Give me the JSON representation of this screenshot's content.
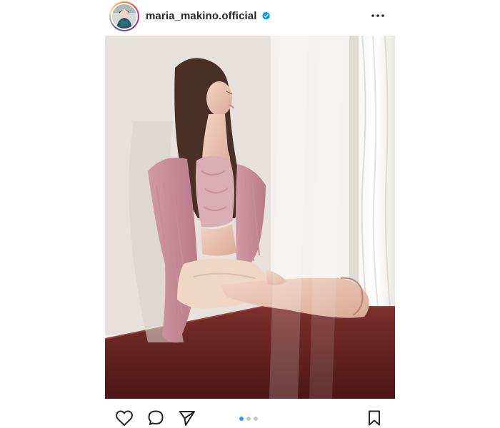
{
  "post": {
    "username": "maria_makino.official",
    "verified": true,
    "carousel": {
      "total": 3,
      "active_index": 0
    },
    "photo": {
      "description_icon": "photo"
    }
  },
  "icons": {
    "verified": "verified-badge-icon",
    "more": "more-options-icon",
    "like": "heart-icon",
    "comment": "comment-icon",
    "share": "paper-plane-icon",
    "save": "bookmark-icon"
  },
  "colors": {
    "accent": "#3897f0",
    "text": "#262626",
    "dot_inactive": "#c8c8c8"
  }
}
